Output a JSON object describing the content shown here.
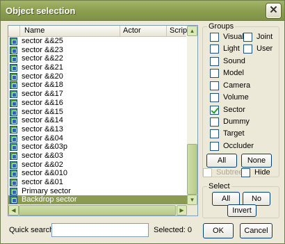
{
  "window": {
    "title": "Object selection",
    "close_glyph": "✕"
  },
  "list": {
    "columns": [
      "Name",
      "Actor",
      "Script"
    ],
    "rows": [
      "sector &&25",
      "sector &&23",
      "sector &&22",
      "sector &&21",
      "sector &&20",
      "sector &&18",
      "sector &&17",
      "sector &&16",
      "sector &&15",
      "sector &&14",
      "sector &&13",
      "sector &&04",
      "sector &&03p",
      "sector &&03",
      "sector &&02",
      "sector &&010",
      "sector &&01",
      "Primary sector",
      "Backdrop sector"
    ],
    "selected_row": "Backdrop sector"
  },
  "groups": {
    "label": "Groups",
    "items": {
      "visual": "Visual",
      "joint": "Joint",
      "light": "Light",
      "user": "User",
      "sound": "Sound",
      "model": "Model",
      "camera": "Camera",
      "volume": "Volume",
      "sector": "Sector",
      "dummy": "Dummy",
      "target": "Target",
      "occluder": "Occluder"
    },
    "checked": [
      "Sector"
    ],
    "all_button": "All",
    "none_button": "None",
    "subtree_label": "Subtree",
    "hide_label": "Hide"
  },
  "select": {
    "label": "Select",
    "all_button": "All",
    "no_button": "No",
    "invert_button": "Invert"
  },
  "footer": {
    "search_label": "Quick search:",
    "search_value": "",
    "selected_label": "Selected: 0",
    "ok_button": "OK",
    "cancel_button": "Cancel"
  },
  "colors": {
    "titlebar": "#8ea152",
    "selection": "#8c9b52",
    "checkmark": "#21a121"
  }
}
